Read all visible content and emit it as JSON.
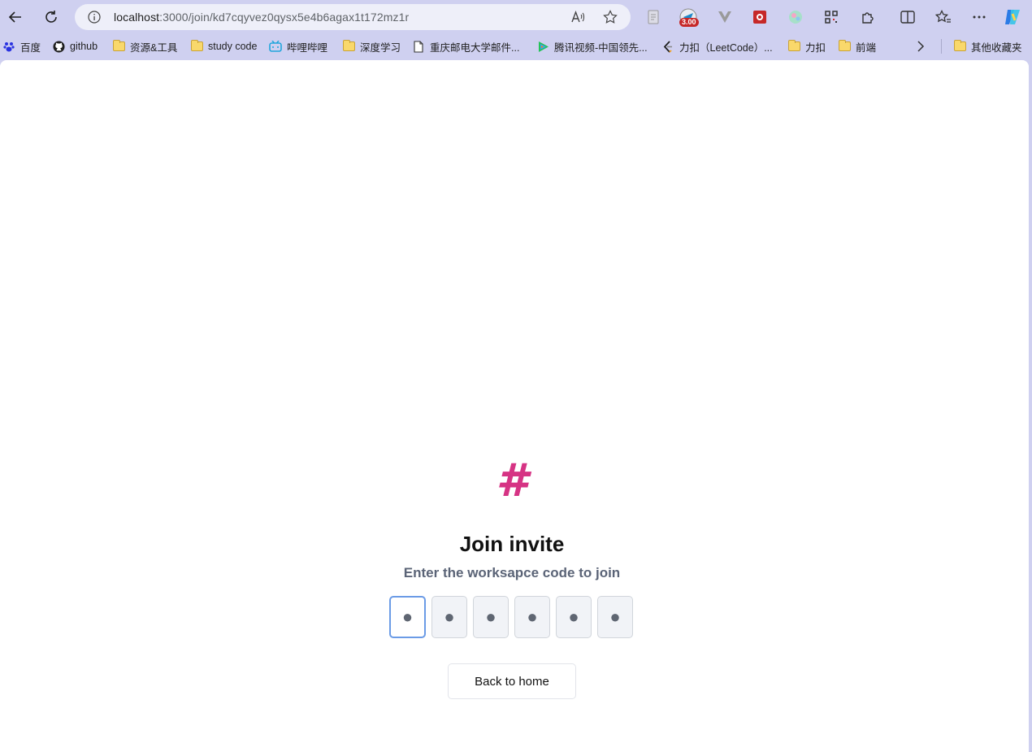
{
  "browser": {
    "url_host": "localhost",
    "url_path": ":3000/join/kd7cqyvez0qysx5e4b6agax1t172mz1r",
    "extension_badge": "3.00",
    "bookmarks": [
      {
        "label": "百度",
        "icon": "baidu-icon"
      },
      {
        "label": "github",
        "icon": "github-icon"
      },
      {
        "label": "资源&工具",
        "icon": "folder-icon"
      },
      {
        "label": "study code",
        "icon": "folder-icon"
      },
      {
        "label": "哔哩哔哩",
        "icon": "bilibili-icon"
      },
      {
        "label": "深度学习",
        "icon": "folder-icon"
      },
      {
        "label": "重庆邮电大学邮件...",
        "icon": "page-icon"
      },
      {
        "label": "腾讯视频-中国领先...",
        "icon": "tencent-video-icon"
      },
      {
        "label": "力扣（LeetCode）...",
        "icon": "leetcode-icon"
      },
      {
        "label": "力扣",
        "icon": "folder-icon"
      },
      {
        "label": "前端",
        "icon": "folder-icon"
      },
      {
        "label": "其他收藏夹",
        "icon": "folder-icon"
      }
    ]
  },
  "page": {
    "logo_symbol": "#",
    "title": "Join invite",
    "subtitle": "Enter the worksapce code to join",
    "code_placeholder": "●",
    "code_length": 6,
    "back_button_label": "Back to home"
  },
  "colors": {
    "brand": "#d63384",
    "focus_border": "#6b9be6"
  }
}
